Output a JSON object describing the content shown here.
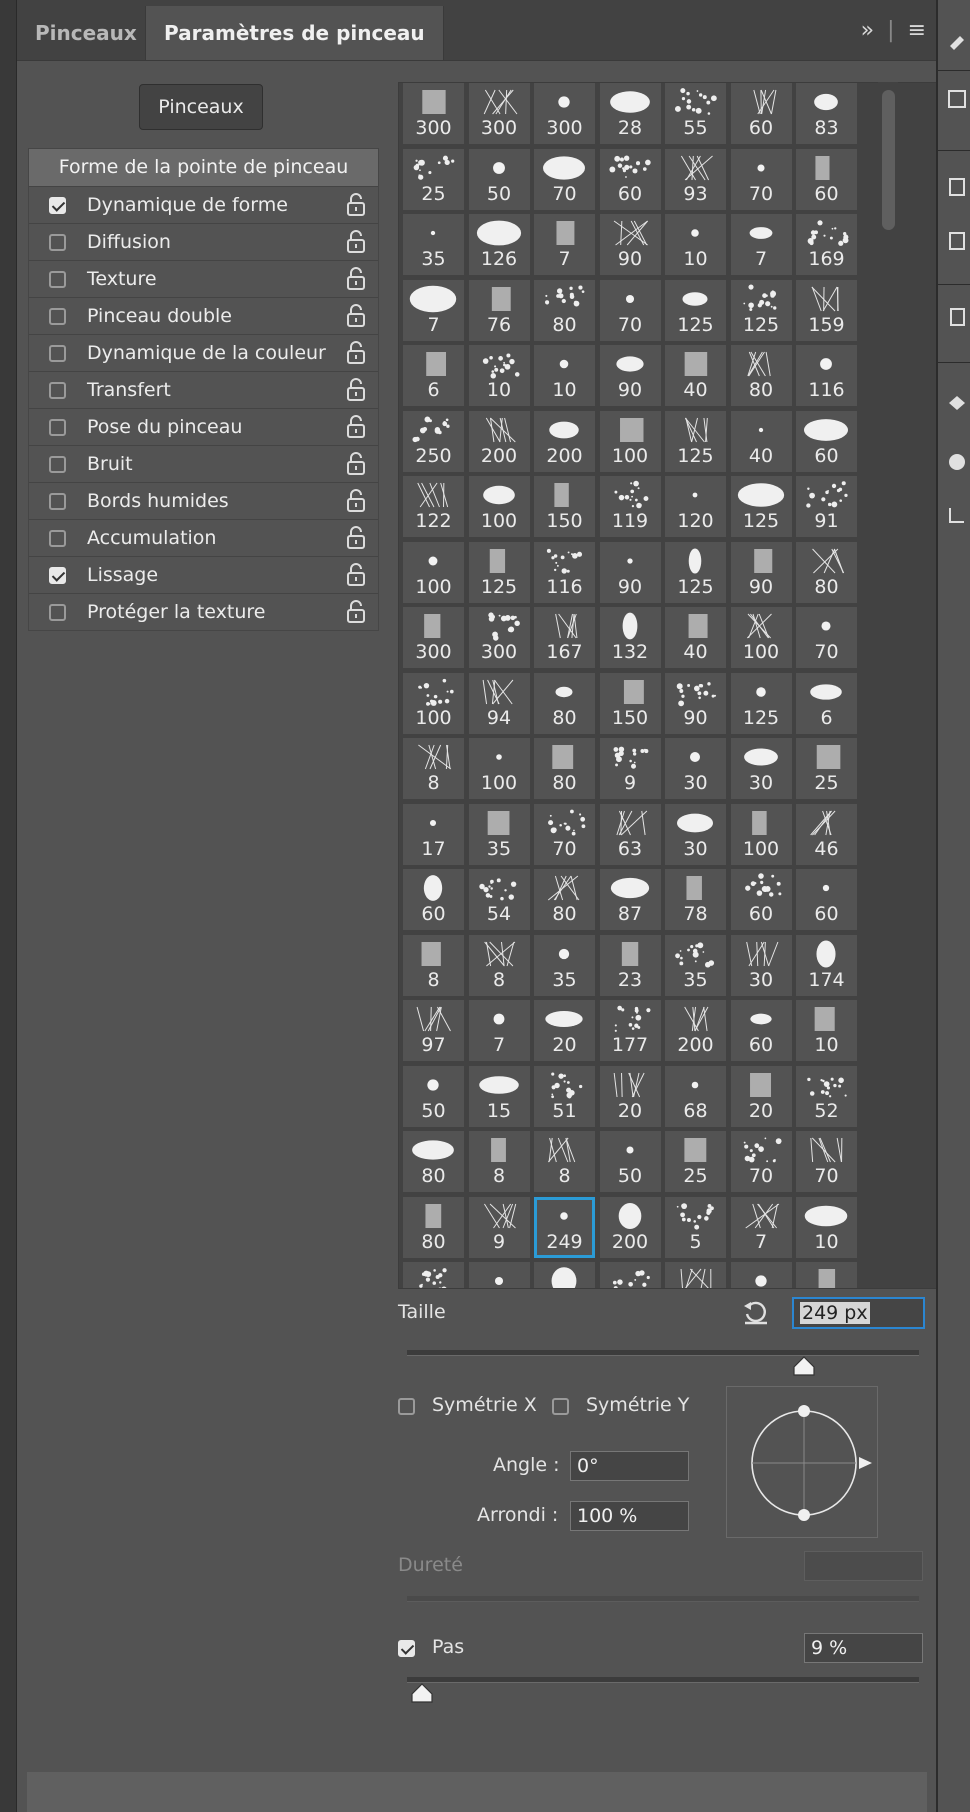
{
  "tabs": [
    {
      "label": "Pinceaux",
      "active": false
    },
    {
      "label": "Paramètres de pinceau",
      "active": true
    }
  ],
  "tab_menu": {
    "expand_icon": "double-chevron-right-icon",
    "menu_icon": "hamburger-icon",
    "expand_text": "»",
    "menu_text": "≡"
  },
  "brushes_button": "Pinceaux",
  "options": {
    "header": "Forme de la pointe de pinceau",
    "items": [
      {
        "label": "Dynamique de forme",
        "checked": true
      },
      {
        "label": "Diffusion",
        "checked": false
      },
      {
        "label": "Texture",
        "checked": false
      },
      {
        "label": "Pinceau double",
        "checked": false
      },
      {
        "label": "Dynamique de la couleur",
        "checked": false
      },
      {
        "label": "Transfert",
        "checked": false
      },
      {
        "label": "Pose du pinceau",
        "checked": false
      },
      {
        "label": "Bruit",
        "checked": false
      },
      {
        "label": "Bords humides",
        "checked": false
      },
      {
        "label": "Accumulation",
        "checked": false
      },
      {
        "label": "Lissage",
        "checked": true
      },
      {
        "label": "Protéger la texture",
        "checked": false
      }
    ]
  },
  "brush_grid": {
    "rows": [
      [
        "300",
        "300",
        "300",
        "28",
        "55",
        "60",
        "83"
      ],
      [
        "25",
        "50",
        "70",
        "60",
        "93",
        "70",
        "60"
      ],
      [
        "35",
        "126",
        "7",
        "90",
        "10",
        "7",
        "169"
      ],
      [
        "7",
        "76",
        "80",
        "70",
        "125",
        "125",
        "159"
      ],
      [
        "6",
        "10",
        "10",
        "90",
        "40",
        "80",
        "116"
      ],
      [
        "250",
        "200",
        "200",
        "100",
        "125",
        "40",
        "60"
      ],
      [
        "122",
        "100",
        "150",
        "119",
        "120",
        "125",
        "91"
      ],
      [
        "100",
        "125",
        "116",
        "90",
        "125",
        "90",
        "80"
      ],
      [
        "300",
        "300",
        "167",
        "132",
        "40",
        "100",
        "70"
      ],
      [
        "100",
        "94",
        "80",
        "150",
        "90",
        "125",
        "6"
      ],
      [
        "8",
        "100",
        "80",
        "9",
        "30",
        "30",
        "25"
      ],
      [
        "17",
        "35",
        "70",
        "63",
        "30",
        "100",
        "46"
      ],
      [
        "60",
        "54",
        "80",
        "87",
        "78",
        "60",
        "60"
      ],
      [
        "8",
        "8",
        "35",
        "23",
        "35",
        "30",
        "174"
      ],
      [
        "97",
        "7",
        "20",
        "177",
        "200",
        "60",
        "10"
      ],
      [
        "50",
        "15",
        "51",
        "20",
        "68",
        "20",
        "52"
      ],
      [
        "80",
        "8",
        "8",
        "50",
        "25",
        "70",
        "70"
      ],
      [
        "80",
        "9",
        "249",
        "200",
        "5",
        "7",
        "10"
      ],
      [
        "",
        "",
        "",
        "",
        "",
        "",
        ""
      ]
    ],
    "selected": {
      "row": 17,
      "col": 2
    }
  },
  "size": {
    "label": "Taille",
    "value": "249 px",
    "reset_icon": "reset-icon",
    "slider_fraction": 0.775
  },
  "symmetry": {
    "x_label": "Symétrie X",
    "y_label": "Symétrie Y",
    "x_checked": false,
    "y_checked": false
  },
  "angle": {
    "label": "Angle :",
    "value": "0°"
  },
  "roundness": {
    "label": "Arrondi :",
    "value": "100 %"
  },
  "hardness": {
    "label": "Dureté",
    "value": "",
    "enabled": false
  },
  "spacing": {
    "label": "Pas",
    "value": "9 %",
    "checked": true,
    "slider_fraction": 0.03
  },
  "colors": {
    "panel": "#535353",
    "tabbar": "#424242",
    "selection": "#2b9bd6",
    "field_focus": "#2b86d1"
  }
}
